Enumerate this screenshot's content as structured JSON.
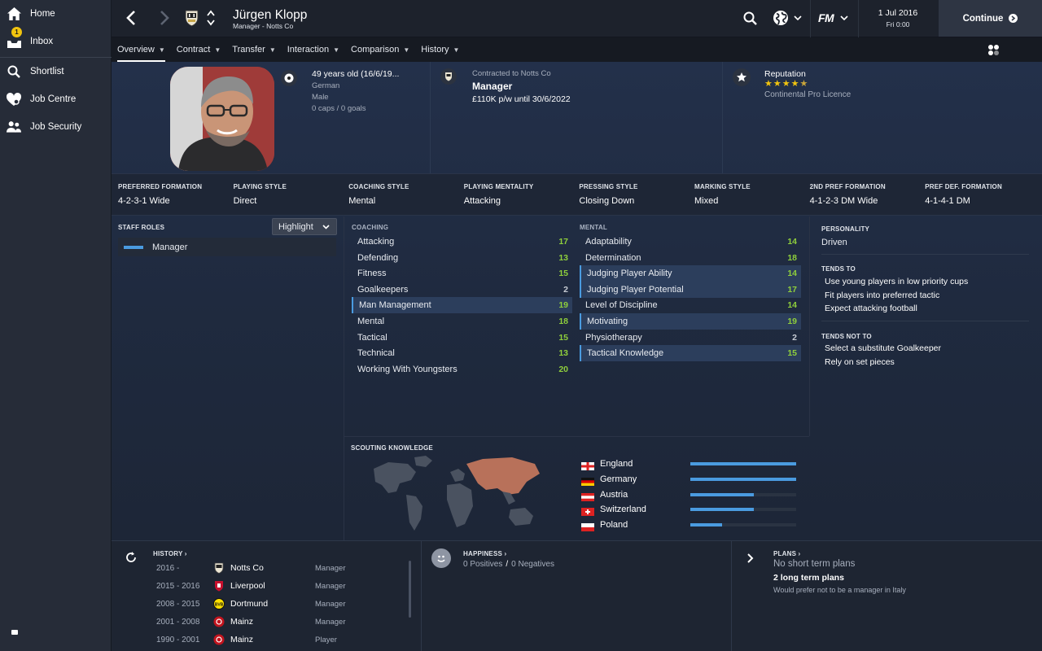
{
  "sidebar": {
    "items": [
      {
        "label": "Home"
      },
      {
        "label": "Inbox",
        "badge": "1"
      },
      {
        "label": "Shortlist"
      },
      {
        "label": "Job Centre"
      },
      {
        "label": "Job Security"
      }
    ]
  },
  "topbar": {
    "name": "Jürgen Klopp",
    "subtitle": "Manager - Notts Co",
    "fm_label": "FM",
    "date": "1 Jul 2016",
    "day": "Fri 0:00",
    "continue_label": "Continue"
  },
  "tabs": [
    {
      "label": "Overview"
    },
    {
      "label": "Contract"
    },
    {
      "label": "Transfer"
    },
    {
      "label": "Interaction"
    },
    {
      "label": "Comparison"
    },
    {
      "label": "History"
    }
  ],
  "profile": {
    "age": "49 years old (16/6/19...",
    "nationality": "German",
    "gender": "Male",
    "caps": "0 caps / 0 goals",
    "contracted_to": "Contracted to Notts Co",
    "role": "Manager",
    "wage": "£110K p/w until 30/6/2022",
    "reputation_label": "Reputation",
    "reputation_stars": 4.5,
    "licence": "Continental Pro Licence"
  },
  "styles": [
    {
      "label": "PREFERRED FORMATION",
      "value": "4-2-3-1 Wide"
    },
    {
      "label": "PLAYING STYLE",
      "value": "Direct"
    },
    {
      "label": "COACHING STYLE",
      "value": "Mental"
    },
    {
      "label": "PLAYING MENTALITY",
      "value": "Attacking"
    },
    {
      "label": "PRESSING STYLE",
      "value": "Closing Down"
    },
    {
      "label": "MARKING STYLE",
      "value": "Mixed"
    },
    {
      "label": "2ND PREF FORMATION",
      "value": "4-1-2-3 DM Wide"
    },
    {
      "label": "PREF DEF. FORMATION",
      "value": "4-1-4-1 DM"
    }
  ],
  "staff_roles": {
    "title": "STAFF ROLES",
    "dropdown": "Highlight",
    "role": "Manager"
  },
  "coaching": {
    "title": "COACHING",
    "items": [
      {
        "label": "Attacking",
        "value": "17",
        "hl": false
      },
      {
        "label": "Defending",
        "value": "13",
        "hl": false
      },
      {
        "label": "Fitness",
        "value": "15",
        "hl": false
      },
      {
        "label": "Goalkeepers",
        "value": "2",
        "hl": false
      },
      {
        "label": "Man Management",
        "value": "19",
        "hl": true
      },
      {
        "label": "Mental",
        "value": "18",
        "hl": false
      },
      {
        "label": "Tactical",
        "value": "15",
        "hl": false
      },
      {
        "label": "Technical",
        "value": "13",
        "hl": false
      },
      {
        "label": "Working With Youngsters",
        "value": "20",
        "hl": false
      }
    ]
  },
  "mental": {
    "title": "MENTAL",
    "items": [
      {
        "label": "Adaptability",
        "value": "14",
        "hl": false
      },
      {
        "label": "Determination",
        "value": "18",
        "hl": false
      },
      {
        "label": "Judging Player Ability",
        "value": "14",
        "hl": true
      },
      {
        "label": "Judging Player Potential",
        "value": "17",
        "hl": true
      },
      {
        "label": "Level of Discipline",
        "value": "14",
        "hl": false
      },
      {
        "label": "Motivating",
        "value": "19",
        "hl": true
      },
      {
        "label": "Physiotherapy",
        "value": "2",
        "hl": false
      },
      {
        "label": "Tactical Knowledge",
        "value": "15",
        "hl": true
      }
    ]
  },
  "personality": {
    "title": "PERSONALITY",
    "value": "Driven",
    "tends_to_title": "TENDS TO",
    "tends_to": [
      "Use young players in low priority cups",
      "Fit players into preferred tactic",
      "Expect attacking football"
    ],
    "tends_not_title": "TENDS NOT TO",
    "tends_not": [
      "Select a substitute Goalkeeper",
      "Rely on set pieces"
    ]
  },
  "scouting": {
    "title": "SCOUTING KNOWLEDGE",
    "countries": [
      {
        "name": "England",
        "level": 1.0
      },
      {
        "name": "Germany",
        "level": 1.0
      },
      {
        "name": "Austria",
        "level": 0.6
      },
      {
        "name": "Switzerland",
        "level": 0.6
      },
      {
        "name": "Poland",
        "level": 0.3
      }
    ]
  },
  "history": {
    "title": "HISTORY",
    "rows": [
      {
        "years": "2016 -",
        "club": "Notts Co",
        "role": "Manager"
      },
      {
        "years": "2015 - 2016",
        "club": "Liverpool",
        "role": "Manager"
      },
      {
        "years": "2008 - 2015",
        "club": "Dortmund",
        "role": "Manager"
      },
      {
        "years": "2001 - 2008",
        "club": "Mainz",
        "role": "Manager"
      },
      {
        "years": "1990 - 2001",
        "club": "Mainz",
        "role": "Player"
      }
    ]
  },
  "happiness": {
    "title": "HAPPINESS",
    "positives": "0 Positives",
    "sep": "/",
    "negatives": "0 Negatives"
  },
  "plans": {
    "title": "PLANS",
    "short": "No short term plans",
    "long": "2 long term plans",
    "note": "Would prefer not to be a manager in Italy"
  }
}
